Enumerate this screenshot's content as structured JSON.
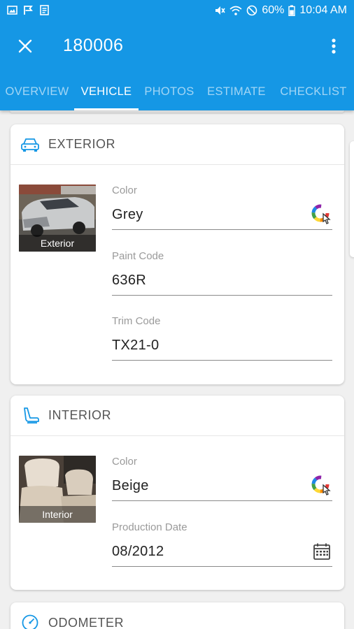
{
  "status_bar": {
    "battery_percent": "60%",
    "time": "10:04 AM",
    "left_icons": [
      "gallery-icon",
      "flag-icon",
      "document-icon"
    ],
    "right_icons": [
      "mute-icon",
      "wifi-icon",
      "do-not-disturb-icon",
      "battery-icon"
    ]
  },
  "toolbar": {
    "title": "180006",
    "close_icon": "close-icon",
    "more_icon": "more-vertical-icon"
  },
  "tabs": [
    {
      "label": "OVERVIEW",
      "active": false
    },
    {
      "label": "VEHICLE",
      "active": true
    },
    {
      "label": "PHOTOS",
      "active": false
    },
    {
      "label": "ESTIMATE",
      "active": false
    },
    {
      "label": "CHECKLIST",
      "active": false
    }
  ],
  "colors": {
    "app_bar": "#1597e5",
    "accent_icon": "#1597e5"
  },
  "exterior": {
    "title": "EXTERIOR",
    "icon": "car-icon",
    "thumb_caption": "Exterior",
    "fields": [
      {
        "label": "Color",
        "value": "Grey",
        "icon": "color-picker-icon"
      },
      {
        "label": "Paint Code",
        "value": "636R"
      },
      {
        "label": "Trim Code",
        "value": "TX21-0"
      }
    ]
  },
  "interior": {
    "title": "INTERIOR",
    "icon": "car-seat-icon",
    "thumb_caption": "Interior",
    "fields": [
      {
        "label": "Color",
        "value": "Beige",
        "icon": "color-picker-icon"
      },
      {
        "label": "Production Date",
        "value": "08/2012",
        "icon": "calendar-icon"
      }
    ]
  },
  "odometer": {
    "title": "ODOMETER",
    "icon": "speedometer-icon"
  }
}
